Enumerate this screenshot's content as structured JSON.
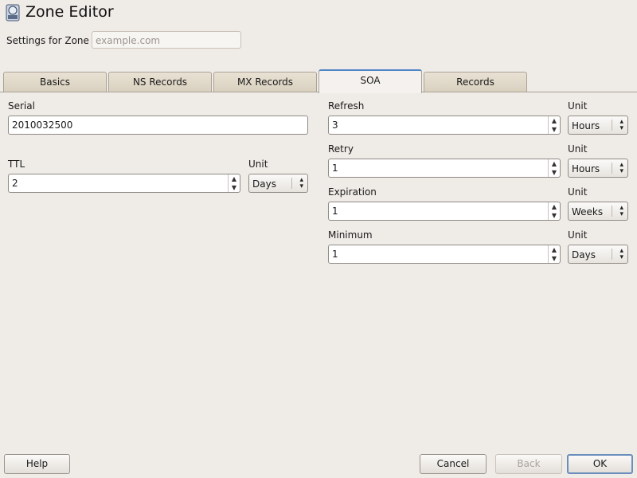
{
  "window": {
    "title": "Zone Editor"
  },
  "zone": {
    "label": "Settings for Zone",
    "placeholder": "example.com"
  },
  "tabs": [
    {
      "label": "Basics"
    },
    {
      "label": "NS Records"
    },
    {
      "label": "MX Records"
    },
    {
      "label": "SOA",
      "active": true
    },
    {
      "label": "Records"
    }
  ],
  "soa": {
    "serial": {
      "label": "Serial",
      "value": "2010032500"
    },
    "ttl": {
      "label": "TTL",
      "value": "2",
      "unit_label": "Unit",
      "unit": "Days"
    },
    "refresh": {
      "label": "Refresh",
      "value": "3",
      "unit_label": "Unit",
      "unit": "Hours"
    },
    "retry": {
      "label": "Retry",
      "value": "1",
      "unit_label": "Unit",
      "unit": "Hours"
    },
    "expiration": {
      "label": "Expiration",
      "value": "1",
      "unit_label": "Unit",
      "unit": "Weeks"
    },
    "minimum": {
      "label": "Minimum",
      "value": "1",
      "unit_label": "Unit",
      "unit": "Days"
    }
  },
  "buttons": {
    "help": "Help",
    "cancel": "Cancel",
    "back": "Back",
    "ok": "OK"
  },
  "icons": {
    "title": "yast-dns-server-icon",
    "spin_up": "▲",
    "spin_down": "▼"
  }
}
